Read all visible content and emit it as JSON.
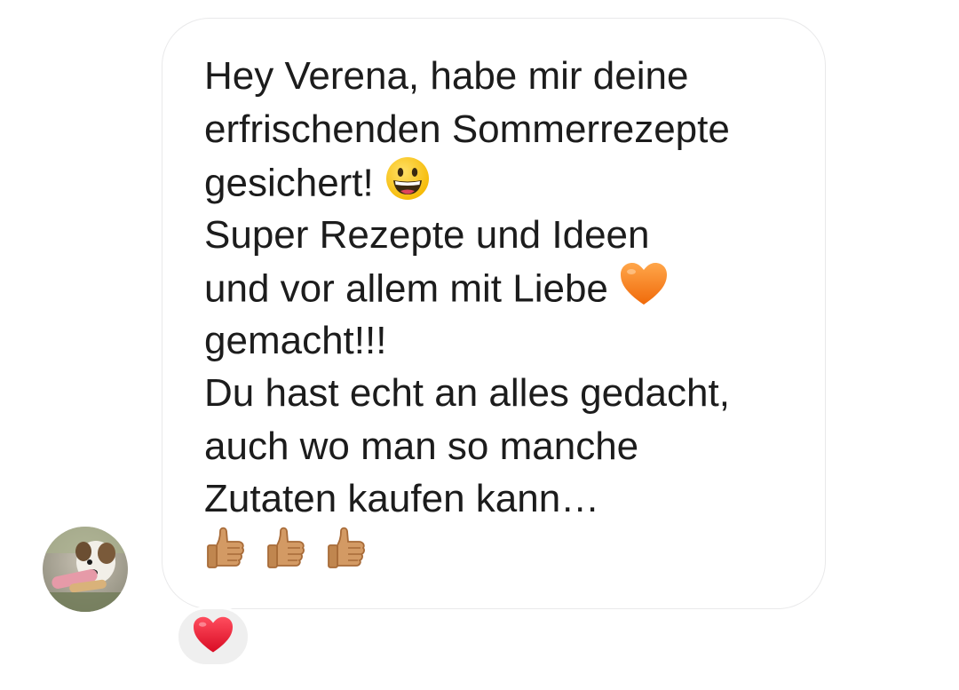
{
  "message": {
    "lines": [
      "Hey Verena, habe mir deine",
      "erfrischenden Sommerrezepte",
      "gesichert!",
      "Super Rezepte und Ideen",
      "und vor allem mit Liebe",
      "gemacht!!!",
      "Du hast echt an alles gedacht,",
      "auch wo man so manche",
      "Zutaten kaufen kann…"
    ],
    "emojis": {
      "line3": "grinning-face-icon",
      "line5": "orange-heart-icon",
      "thumbs": [
        "thumbs-up-icon",
        "thumbs-up-icon",
        "thumbs-up-icon"
      ]
    }
  },
  "reaction": {
    "icon": "red-heart-icon"
  },
  "colors": {
    "text": "#1c1c1c",
    "bubble_border": "#e9e9ea",
    "reaction_bg": "#efefef",
    "heart_red": "#e8132e",
    "heart_orange": "#f7801e"
  }
}
